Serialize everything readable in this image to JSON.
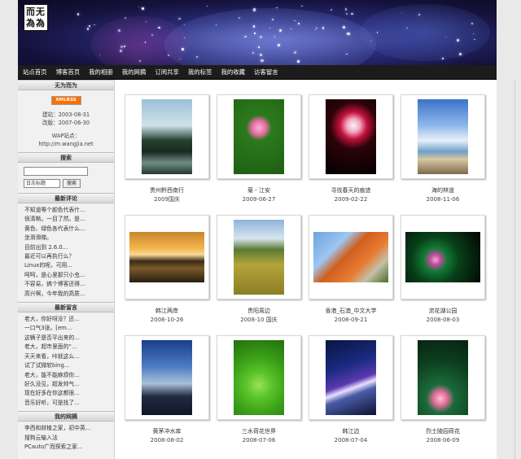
{
  "logo": {
    "text": "而无\n為為"
  },
  "nav": [
    "站点首页",
    "博客首页",
    "我的相册",
    "我的网摘",
    "订阅共享",
    "我的标签",
    "我的收藏",
    "访客留言"
  ],
  "sidebar": {
    "about": {
      "title": "无为而为",
      "rss_badge": "XMLRSS 2.0",
      "built": "建站：2003-08-31",
      "redesign": "改版：2007-06-30",
      "wap_label": "WAP站点：",
      "wap_url": "http://m.wangjia.net"
    },
    "search": {
      "title": "搜索",
      "select": "日志标题",
      "button": "搜索"
    },
    "comments": {
      "title": "最新评论",
      "items": [
        "不知道等个颜色代表什...",
        "很清晰。一目了然。是...",
        "黄色、绿色各代表什么...",
        "坐滑滑梯。",
        "目前出到 2.6.0...",
        "最近可以再执行么？",
        "Linux的呢，可用...",
        "呵呵，是心里那只小虫...",
        "不容易，搞个博客还得...",
        "高兴啊，今年我的高质..."
      ]
    },
    "messages": {
      "title": "最新留言",
      "items": [
        "老大，你好呀没？还...",
        "一口气3张。[em...",
        "这辆子是否平出来的...",
        "老大，超市里面的“...",
        "天天来看，咔就这么...",
        "试了试微软bing...",
        "老大，能不能麻烦你...",
        "好久没见，超发帅气...",
        "现在好多在你这都很...",
        "音乐好听，可是找了..."
      ]
    },
    "bookmarks": {
      "title": "我的网摘",
      "items": [
        "李西和财植之家，初中英...",
        "搜狗云输入法",
        "PCauto广而探索之家..."
      ]
    }
  },
  "photos": [
    {
      "title": "贵州黔西南行",
      "date": "2009国庆",
      "orient": "port",
      "bg": "linear-gradient(#9cc0d8 0%, #cfe2ea 35%, #24412f 55%, #1a2a20 70%, #6f8d86 85%, #253630 100%)"
    },
    {
      "title": "菊 - 江安",
      "date": "2009-06-27",
      "orient": "port",
      "bg": "radial-gradient(circle at 50% 38%, #f4b4d0 0%, #e26aa0 14%, #2c7a1c 24%, #1e5e14 100%)"
    },
    {
      "title": "寻找春天的痕迹",
      "date": "2009-02-22",
      "orient": "port",
      "bg": "radial-gradient(circle at 55% 35%, #fff2f6 0%, #f1a6c0 12%, #c2113c 24%, #2b0308 42%, #020000 100%)"
    },
    {
      "title": "海的林道",
      "date": "2008-11-06",
      "orient": "port",
      "bg": "linear-gradient(#3a73c8 0%, #8fb7ea 35%, #e8f0f8 55%, #6fa0c8 70%, #d8c8a0 80%, #7e6a4c 100%)"
    },
    {
      "title": "韩江两岸",
      "date": "2008-10-26",
      "orient": "land",
      "bg": "linear-gradient(#c8862e 0%, #f4b44a 32%, #f8d898 45%, #3b2a17 58%, #7a5a2a 72%, #2a1e12 100%)"
    },
    {
      "title": "贵阳周边",
      "date": "2008-10 国庆",
      "orient": "port",
      "bg": "linear-gradient(#8fb3d8 0%, #d6e6f0 25%, #5a7a34 40%, #b5a43a 60%, #8a7e24 100%)"
    },
    {
      "title": "香港_石澳_中文大学",
      "date": "2008-09-21",
      "orient": "land",
      "bg": "linear-gradient(135deg, #6da2e0 0%, #9ec6f0 30%, #d06020 45%, #e87a30 65%, #c6c0a8 80%, #4b6b2b 100%)"
    },
    {
      "title": "流花湖公园",
      "date": "2008-08-03",
      "orient": "land",
      "bg": "radial-gradient(circle at 40% 55%, #f1a8d6 0%, #c04c9e 10%, #127a36 22%, #084019 45%, #010402 100%)"
    },
    {
      "title": "黄茅冲水库",
      "date": "2008-08-02",
      "orient": "port",
      "bg": "linear-gradient(#1a3d8c 0%, #4b7cc4 35%, #a8c0d8 58%, #222a40 75%, #10162a 100%)"
    },
    {
      "title": "三水荷花世界",
      "date": "2008-07-06",
      "orient": "port",
      "bg": "radial-gradient(circle at 50% 60%, #9ae25a 0%, #5bc42a 25%, #3aa018 55%, #246e0e 100%)"
    },
    {
      "title": "韩江边",
      "date": "2008-07-04",
      "orient": "port",
      "bg": "linear-gradient(160deg, #0a1440 0%, #1a2a80 35%, #5a3ab0 55%, #e8e0ff 62%, #4a5ca8 70%, #0c1230 100%)"
    },
    {
      "title": "烈士陵园荷花",
      "date": "2008-06-09",
      "orient": "port",
      "bg": "radial-gradient(circle at 45% 78%, #f7c4d8 0%, #e8709e 10%, #1b6a3a 22%, #0d3e1e 60%, #062312 100%)"
    }
  ]
}
